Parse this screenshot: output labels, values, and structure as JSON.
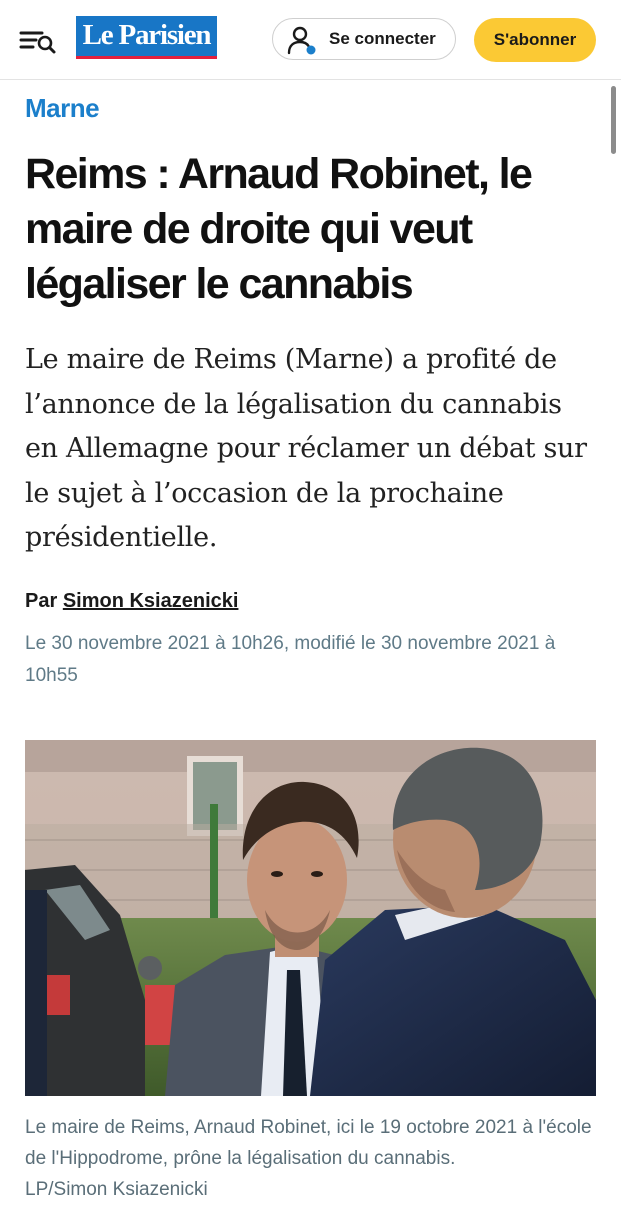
{
  "header": {
    "logo_text": "Le Parisien",
    "connect_label": "Se connecter",
    "subscribe_label": "S'abonner"
  },
  "article": {
    "section": "Marne",
    "title": "Reims : Arnaud Robinet, le maire de droite qui veut légaliser le cannabis",
    "lead": "Le maire de Reims (Marne) a profité de l’annonce de la légalisation du cannabis en Allemagne pour réclamer un débat sur le sujet à l’occasion de la prochaine présidentielle.",
    "byline_prefix": "Par",
    "author": "Simon Ksiazenicki",
    "date": "Le 30 novembre 2021 à 10h26, modifié le 30 novembre 2021 à 10h55",
    "photo_caption": "Le maire de Reims, Arnaud Robinet, ici le 19 octobre 2021 à l'école de l'Hippodrome, prône la légalisation du cannabis.",
    "photo_credit": "LP/Simon Ksiazenicki"
  },
  "colors": {
    "brand_blue": "#1876c6",
    "section_blue": "#1b7fcb",
    "subscribe_yellow": "#fbc934",
    "logo_underline_red": "#e3203e",
    "date_gray": "#5f7a87"
  },
  "icons": {
    "menu": "menu-search-icon",
    "user": "user-icon",
    "status_dot": "status-dot-icon"
  }
}
